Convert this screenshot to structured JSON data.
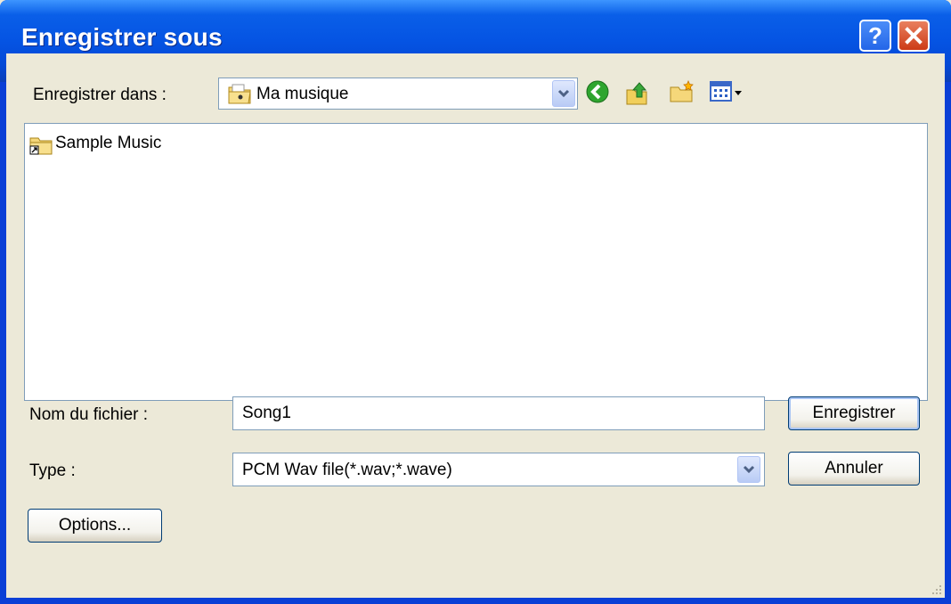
{
  "window": {
    "title": "Enregistrer sous",
    "help_button": "?",
    "close_button": "close"
  },
  "location": {
    "label": "Enregistrer dans :",
    "value": "Ma musique"
  },
  "toolbar": {
    "icons": [
      "back-icon",
      "up-folder-icon",
      "new-folder-icon",
      "view-menu-icon"
    ]
  },
  "files": [
    {
      "name": "Sample Music",
      "icon": "folder-shortcut-icon"
    }
  ],
  "filename": {
    "label": "Nom du fichier :",
    "value": "Song1"
  },
  "filetype": {
    "label": "Type :",
    "value": "PCM Wav file(*.wav;*.wave)"
  },
  "buttons": {
    "save": "Enregistrer",
    "cancel": "Annuler",
    "options": "Options..."
  },
  "colors": {
    "titlebar": "#0554e3",
    "client_bg": "#ece9d8",
    "field_border": "#7f9db9"
  }
}
